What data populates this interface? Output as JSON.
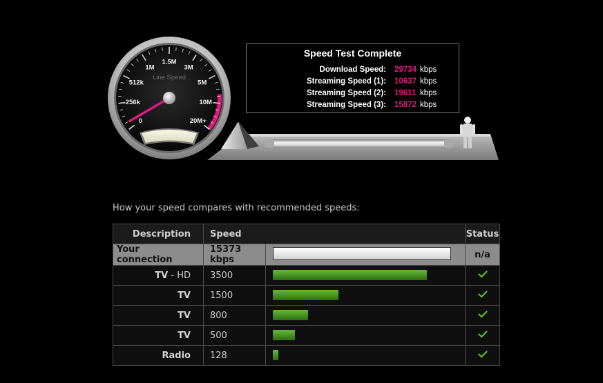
{
  "gauge": {
    "center_label": "Line Speed",
    "ticks": [
      "0",
      "256k",
      "512k",
      "1M",
      "1.5M",
      "3M",
      "5M",
      "10M",
      "20M+"
    ],
    "needle_speed_kbps": 15373,
    "accent_color": "#e0187e"
  },
  "results": {
    "title": "Speed Test Complete",
    "rows": [
      {
        "label": "Download Speed:",
        "value": "29734",
        "unit": "kbps"
      },
      {
        "label": "Streaming Speed (1):",
        "value": "10637",
        "unit": "kbps"
      },
      {
        "label": "Streaming Speed (2):",
        "value": "19611",
        "unit": "kbps"
      },
      {
        "label": "Streaming Speed (3):",
        "value": "15872",
        "unit": "kbps"
      }
    ]
  },
  "compare": {
    "heading": "How your speed compares with recommended speeds:",
    "headers": {
      "description": "Description",
      "speed": "Speed",
      "status": "Status"
    },
    "your_row": {
      "description": "Your connection",
      "speed": "15373 kbps",
      "status": "n/a"
    },
    "rows": [
      {
        "description": "TV",
        "qualifier": "HD",
        "speed": "3500",
        "fill": 0.87,
        "status_icon": "check-icon"
      },
      {
        "description": "TV",
        "qualifier": "",
        "speed": "1500",
        "fill": 0.37,
        "status_icon": "check-icon"
      },
      {
        "description": "TV",
        "qualifier": "",
        "speed": "800",
        "fill": 0.198,
        "status_icon": "check-icon"
      },
      {
        "description": "TV",
        "qualifier": "",
        "speed": "500",
        "fill": 0.124,
        "status_icon": "check-icon"
      },
      {
        "description": "Radio",
        "qualifier": "",
        "speed": "128",
        "fill": 0.032,
        "status_icon": "check-icon"
      }
    ],
    "colors": {
      "bar_green": "#4a9a25",
      "check": "#5cbf2a"
    }
  }
}
